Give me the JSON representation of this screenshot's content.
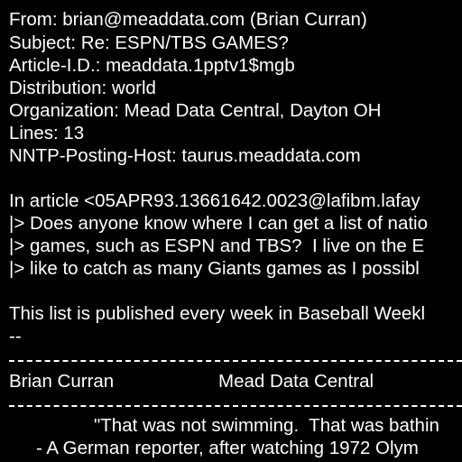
{
  "headers": {
    "from": "From: brian@meaddata.com (Brian Curran)",
    "subject": "Subject: Re: ESPN/TBS GAMES?",
    "article_id": "Article-I.D.: meaddata.1pptv1$mgb",
    "distribution": "Distribution: world",
    "organization": "Organization: Mead Data Central, Dayton OH",
    "lines": "Lines: 13",
    "nntp_host": "NNTP-Posting-Host: taurus.meaddata.com"
  },
  "body": {
    "attribution": "In article <05APR93.13661642.0023@lafibm.lafay",
    "quote": [
      "|> Does anyone know where I can get a list of natio",
      "|> games, such as ESPN and TBS?  I live on the E",
      "|> like to catch as many Giants games as I possibl"
    ],
    "reply": "This list is published every week in Baseball Weekl",
    "sig_dashes": "--"
  },
  "signature": {
    "name": "Brian Curran",
    "company": "Mead Data Central",
    "quote": "\"That was not swimming.  That was bathin",
    "quote_source": "- A German reporter, after watching 1972 Olym"
  },
  "colors": {
    "background": "#000000",
    "text": "#ffffff"
  }
}
